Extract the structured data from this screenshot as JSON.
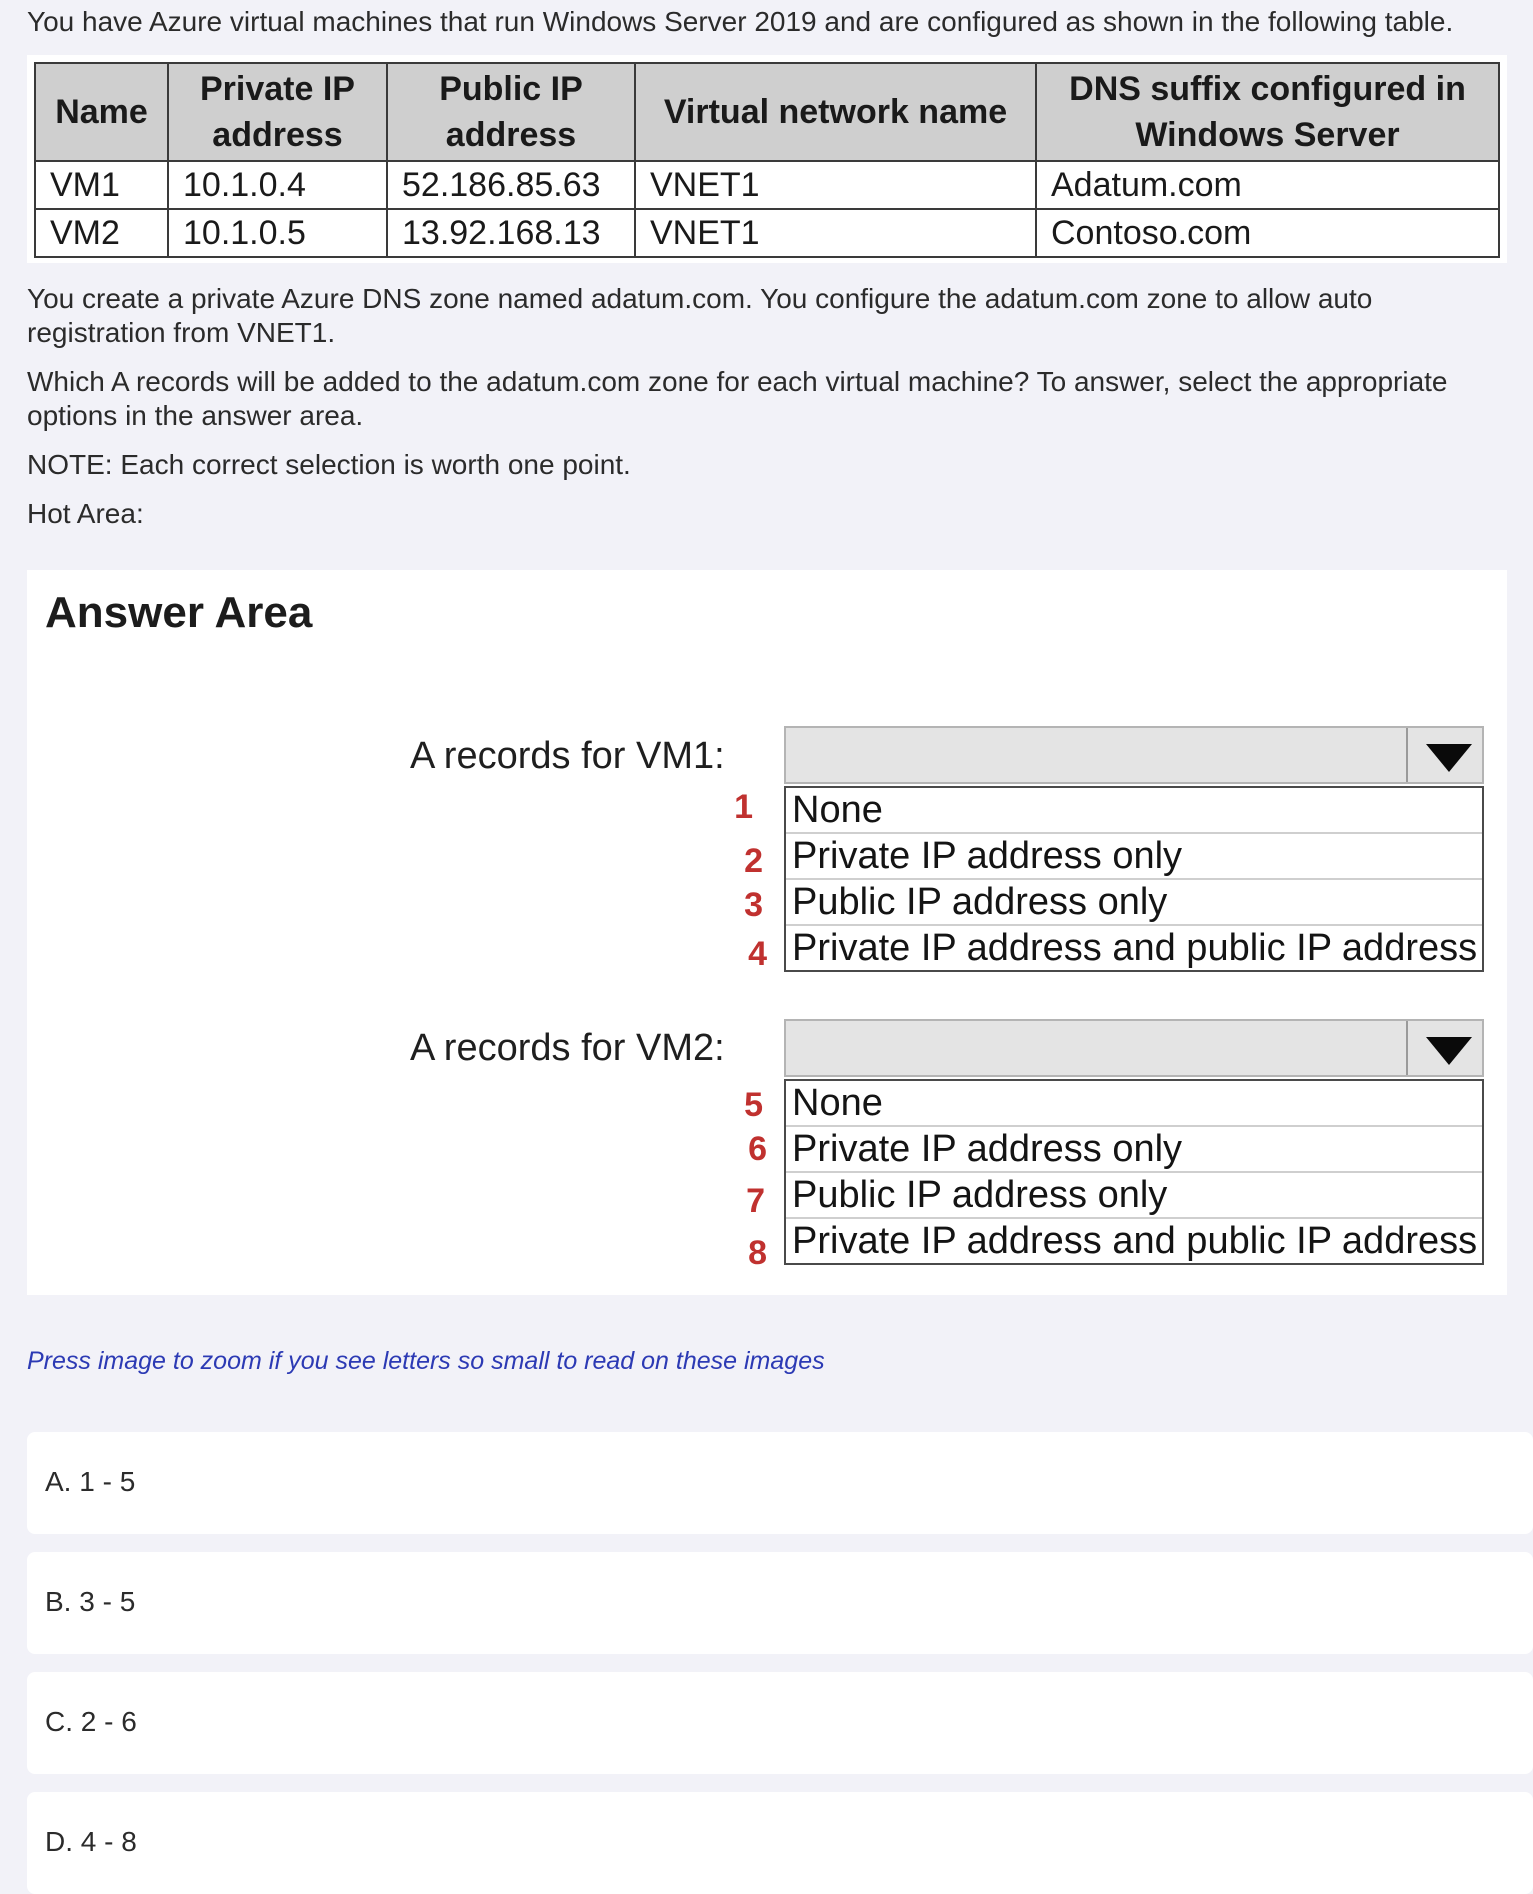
{
  "question": {
    "intro": "You have Azure virtual machines that run Windows Server 2019 and are configured as shown in the following table.",
    "paragraph1": "You create a private Azure DNS zone named adatum.com. You configure the adatum.com zone to allow auto registration from VNET1.",
    "paragraph2": "Which A records will be added to the adatum.com zone for each virtual machine? To answer, select the appropriate options in the answer area.",
    "note": "NOTE: Each correct selection is worth one point.",
    "hot_area": "Hot Area:"
  },
  "vm_table": {
    "headers": [
      "Name",
      "Private IP address",
      "Public IP address",
      "Virtual network name",
      "DNS suffix configured in Windows Server"
    ],
    "rows": [
      [
        "VM1",
        "10.1.0.4",
        "52.186.85.63",
        "VNET1",
        "Adatum.com"
      ],
      [
        "VM2",
        "10.1.0.5",
        "13.92.168.13",
        "VNET1",
        "Contoso.com"
      ]
    ]
  },
  "answer_area": {
    "title": "Answer Area",
    "vm1": {
      "label": "A records for VM1:",
      "numbers": [
        "1",
        "2",
        "3",
        "4"
      ],
      "options": [
        "None",
        "Private IP address only",
        "Public IP address only",
        "Private IP address and public IP address"
      ]
    },
    "vm2": {
      "label": "A records for VM2:",
      "numbers": [
        "5",
        "6",
        "7",
        "8"
      ],
      "options": [
        "None",
        "Private IP address only",
        "Public IP address only",
        "Private IP address and public IP address"
      ]
    }
  },
  "zoom_note": "Press image to zoom if you see letters so small to read on these images",
  "choices": [
    "A. 1 - 5",
    "B. 3 - 5",
    "C. 2 - 6",
    "D. 4 - 8"
  ],
  "colors": {
    "background": "#f2f2f8",
    "number_red": "#c0312f",
    "note_blue": "#2c3ab4",
    "header_gray": "#cfcfcf"
  }
}
